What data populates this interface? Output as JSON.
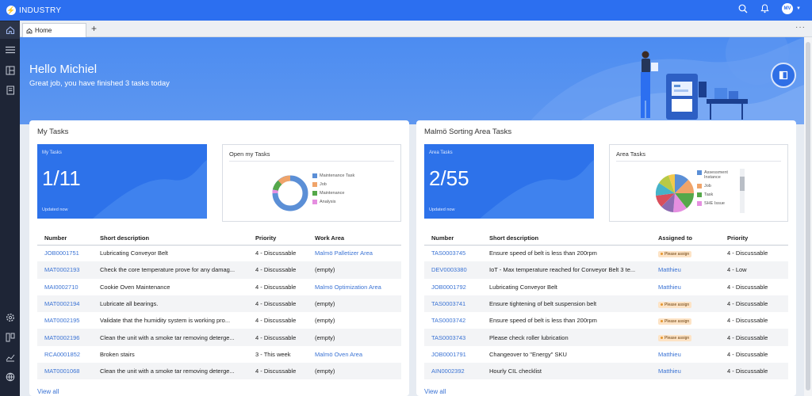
{
  "app": {
    "brand": "INDUSTRY",
    "avatar": "MV"
  },
  "tabs": {
    "home": "Home"
  },
  "hero": {
    "greeting": "Hello Michiel",
    "subtitle": "Great job, you have finished 3 tasks today"
  },
  "my_tasks": {
    "title": "My Tasks",
    "kpi": {
      "label": "My Tasks",
      "value": "1/11",
      "updated": "Updated now"
    },
    "chart_title": "Open my Tasks",
    "legend": [
      {
        "label": "Maintenance Task",
        "color": "#5b8fd6"
      },
      {
        "label": "Job",
        "color": "#f0a46a"
      },
      {
        "label": "Maintenance",
        "color": "#55a84a"
      },
      {
        "label": "Analysis",
        "color": "#e58fe0"
      }
    ],
    "columns": [
      "Number",
      "Short description",
      "Priority",
      "Work Area"
    ],
    "rows": [
      {
        "number": "JOB0001751",
        "desc": "Lubricating Conveyor Belt",
        "priority": "4 - Discussable",
        "area": "Malmö Palletizer Area",
        "area_link": true
      },
      {
        "number": "MAT0002193",
        "desc": "Check the core temperature prove for any damag...",
        "priority": "4 - Discussable",
        "area": "(empty)",
        "area_link": false
      },
      {
        "number": "MAI0002710",
        "desc": "Cookie Oven Maintenance",
        "priority": "4 - Discussable",
        "area": "Malmö Optimization Area",
        "area_link": true
      },
      {
        "number": "MAT0002194",
        "desc": "Lubricate all bearings.",
        "priority": "4 - Discussable",
        "area": "(empty)",
        "area_link": false
      },
      {
        "number": "MAT0002195",
        "desc": "Validate that the humidity system is working pro...",
        "priority": "4 - Discussable",
        "area": "(empty)",
        "area_link": false
      },
      {
        "number": "MAT0002196",
        "desc": "Clean the unit with a smoke tar removing deterge...",
        "priority": "4 - Discussable",
        "area": "(empty)",
        "area_link": false
      },
      {
        "number": "RCA0001852",
        "desc": "Broken stairs",
        "priority": "3 - This week",
        "area": "Malmö Oven Area",
        "area_link": true
      },
      {
        "number": "MAT0001068",
        "desc": "Clean the unit with a smoke tar removing deterge...",
        "priority": "4 - Discussable",
        "area": "(empty)",
        "area_link": false
      }
    ],
    "view_all": "View all"
  },
  "area_tasks": {
    "title": "Malmö Sorting Area Tasks",
    "kpi": {
      "label": "Area Tasks",
      "value": "2/55",
      "updated": "Updated now"
    },
    "chart_title": "Area Tasks",
    "legend": [
      {
        "label": "Assessment Instance",
        "color": "#5b8fd6"
      },
      {
        "label": "Job",
        "color": "#f0a46a"
      },
      {
        "label": "Task",
        "color": "#55a84a"
      },
      {
        "label": "SHE Issue",
        "color": "#e58fe0"
      }
    ],
    "columns": [
      "Number",
      "Short description",
      "Assigned to",
      "Priority"
    ],
    "rows": [
      {
        "number": "TAS0003745",
        "desc": "Ensure speed of belt is less than 200rpm",
        "assigned": "Please assign",
        "badge": true,
        "priority": "4 - Discussable"
      },
      {
        "number": "DEV0003380",
        "desc": "IoT - Max temperature reached for Conveyor Belt 3 te...",
        "assigned": "Matthieu",
        "badge": false,
        "priority": "4 - Low"
      },
      {
        "number": "JOB0001792",
        "desc": "Lubricating Conveyor Belt",
        "assigned": "Matthieu",
        "badge": false,
        "priority": "4 - Discussable"
      },
      {
        "number": "TAS0003741",
        "desc": "Ensure tightening of belt suspension belt",
        "assigned": "Please assign",
        "badge": true,
        "priority": "4 - Discussable"
      },
      {
        "number": "TAS0003742",
        "desc": "Ensure speed of belt is less than 200rpm",
        "assigned": "Please assign",
        "badge": true,
        "priority": "4 - Discussable"
      },
      {
        "number": "TAS0003743",
        "desc": "Please check roller lubrication",
        "assigned": "Please assign",
        "badge": true,
        "priority": "4 - Discussable"
      },
      {
        "number": "JOB0001791",
        "desc": "Changeover to \"Energy\" SKU",
        "assigned": "Matthieu",
        "badge": false,
        "priority": "4 - Discussable"
      },
      {
        "number": "AIN0002392",
        "desc": "Hourly CIL checklist",
        "assigned": "Matthieu",
        "badge": false,
        "priority": "4 - Discussable"
      }
    ],
    "view_all": "View all"
  },
  "colors": {
    "primary": "#2c6ff0",
    "link": "#3b73d4",
    "badge_bg": "#fde3c5"
  }
}
